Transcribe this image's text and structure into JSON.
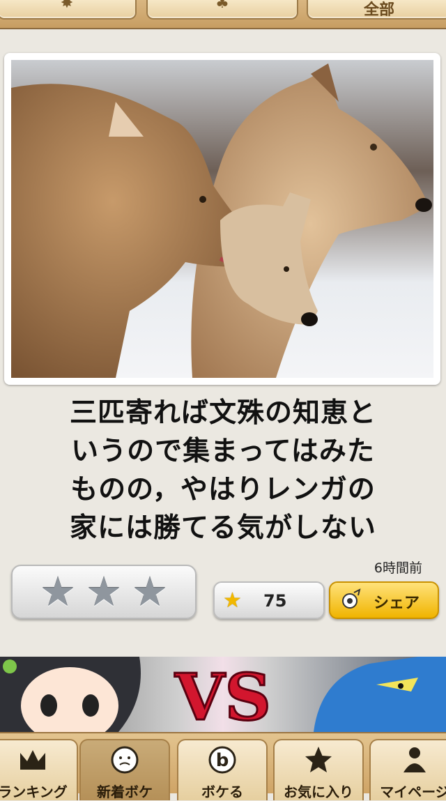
{
  "filters": [
    {
      "name": "new-filter",
      "icon": "sparkle-icon",
      "label": ""
    },
    {
      "name": "boke-filter",
      "icon": "sprout-icon",
      "label": ""
    },
    {
      "name": "all-filter",
      "icon": "",
      "label": "全部"
    }
  ],
  "post": {
    "caption_lines": [
      "三匹寄れば文殊の知恵と",
      "いうので集まってはみた",
      "ものの，やはりレンガの",
      "家には勝てる気がしない"
    ],
    "time": "6時間前",
    "stars_count": "75",
    "share_label": "シェア"
  },
  "tabs": [
    {
      "label": "ランキング",
      "icon": "crown-icon"
    },
    {
      "label": "新着ボケ",
      "icon": "new-face-icon"
    },
    {
      "label": "ボケる",
      "icon": "boke-b-icon"
    },
    {
      "label": "お気に入り",
      "icon": "star-icon"
    },
    {
      "label": "マイページ",
      "icon": "person-icon"
    }
  ],
  "colors": {
    "accent": "#f0b400",
    "wood": "#cfa466",
    "star_gray": "#8f969e"
  }
}
